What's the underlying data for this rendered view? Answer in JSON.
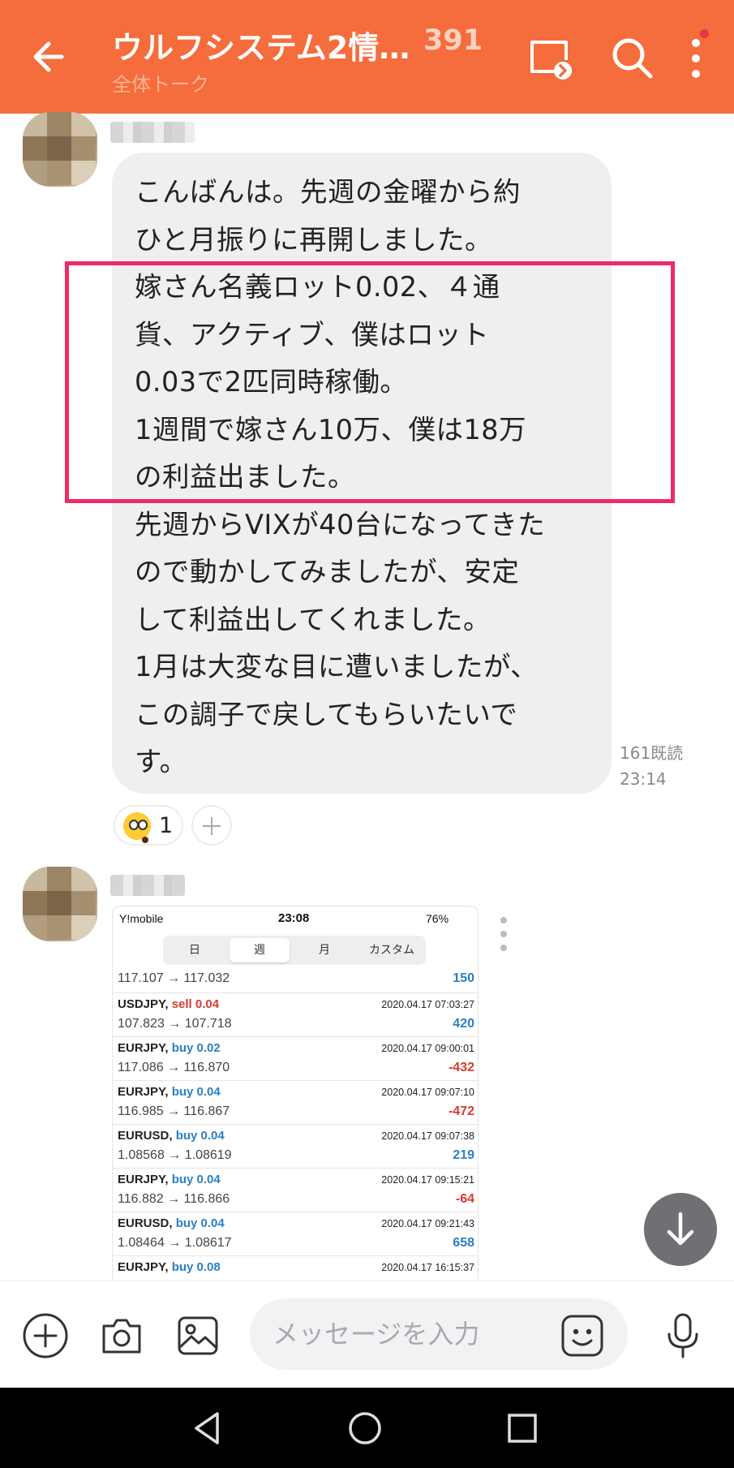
{
  "header": {
    "title": "ウルフシステム2情…",
    "member_count": "391",
    "subtitle": "全体トーク",
    "colors": {
      "bar": "#f56d3c",
      "notification_dot": "#e8344a"
    }
  },
  "message1": {
    "lines": [
      "こんばんは。先週の金曜から約",
      "ひと月振りに再開しました。",
      "嫁さん名義ロット0.02、４通",
      "貨、アクティブ、僕はロット",
      "0.03で2匹同時稼働。",
      "1週間で嫁さん10万、僕は18万",
      "の利益出ました。",
      "先週からVIXが40台になってきた",
      "ので動かしてみましたが、安定",
      "して利益出してくれました。",
      "1月は大変な目に遭いましたが、",
      "この調子で戻してもらいたいで",
      "す。"
    ],
    "read_count": "161既読",
    "time": "23:14",
    "reaction": {
      "emoji": "astonished-face",
      "count": "1"
    }
  },
  "message2": {
    "image": {
      "status_bar": {
        "carrier": "Y!mobile",
        "time": "23:08",
        "battery": "76%"
      },
      "segments": [
        "日",
        "週",
        "月",
        "カスタム"
      ],
      "active_segment": "週",
      "partial_row": {
        "prices": "117.107 → 117.032",
        "profit": "150"
      },
      "trades": [
        {
          "symbol": "USDJPY,",
          "side": "sell 0.04",
          "date": "2020.04.17 07:03:27",
          "prices": "107.823 → 107.718",
          "profit": "420",
          "positive": true
        },
        {
          "symbol": "EURJPY,",
          "side": "buy 0.02",
          "date": "2020.04.17 09:00:01",
          "prices": "117.086 → 116.870",
          "profit": "-432",
          "positive": false
        },
        {
          "symbol": "EURJPY,",
          "side": "buy 0.04",
          "date": "2020.04.17 09:07:10",
          "prices": "116.985 → 116.867",
          "profit": "-472",
          "positive": false
        },
        {
          "symbol": "EURUSD,",
          "side": "buy 0.04",
          "date": "2020.04.17 09:07:38",
          "prices": "1.08568 → 1.08619",
          "profit": "219",
          "positive": true
        },
        {
          "symbol": "EURJPY,",
          "side": "buy 0.04",
          "date": "2020.04.17 09:15:21",
          "prices": "116.882 → 116.866",
          "profit": "-64",
          "positive": false
        },
        {
          "symbol": "EURUSD,",
          "side": "buy 0.04",
          "date": "2020.04.17 09:21:43",
          "prices": "1.08464 → 1.08617",
          "profit": "658",
          "positive": true
        },
        {
          "symbol": "EURJPY,",
          "side": "buy 0.08",
          "date": "2020.04.17 16:15:37",
          "prices": "",
          "profit": "",
          "positive": true
        }
      ],
      "colors": {
        "buy": "#2a7fc4",
        "sell": "#d93a2f",
        "profit_pos": "#2a7fc4",
        "profit_neg": "#d93a2f"
      }
    }
  },
  "composer": {
    "placeholder": "メッセージを入力"
  }
}
